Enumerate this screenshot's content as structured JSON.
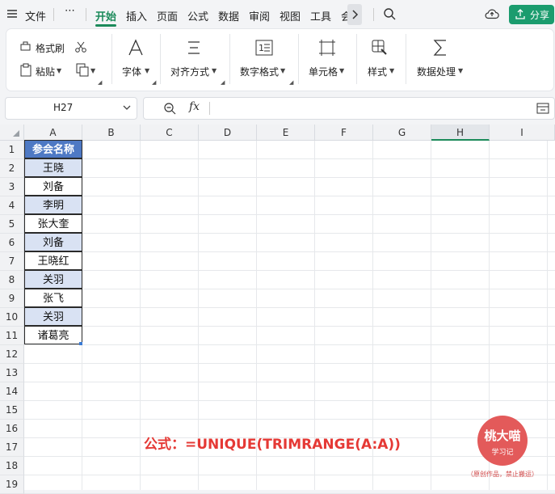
{
  "menu": {
    "file": "文件",
    "more": "⋯",
    "tabs": [
      "开始",
      "插入",
      "页面",
      "公式",
      "数据",
      "审阅",
      "视图",
      "工具",
      "会"
    ],
    "share": "分享"
  },
  "ribbon": {
    "format_painter": "格式刷",
    "paste": "粘贴",
    "font": "字体",
    "align": "对齐方式",
    "number_format": "数字格式",
    "cell": "单元格",
    "style": "样式",
    "data_process": "数据处理"
  },
  "formula_bar": {
    "name_box": "H27",
    "fx": "fx",
    "value": ""
  },
  "grid": {
    "columns": [
      "A",
      "B",
      "C",
      "D",
      "E",
      "F",
      "G",
      "H",
      "I"
    ],
    "selected_column": "H",
    "rows": [
      "1",
      "2",
      "3",
      "4",
      "5",
      "6",
      "7",
      "8",
      "9",
      "10",
      "11",
      "12",
      "13",
      "14",
      "15",
      "16",
      "17",
      "18",
      "19"
    ],
    "column_a": [
      "参会名称",
      "王晓",
      "刘备",
      "李明",
      "张大奎",
      "刘备",
      "王晓红",
      "关羽",
      "张飞",
      "关羽",
      "诸葛亮"
    ]
  },
  "overlay": {
    "formula": "公式：=UNIQUE(TRIMRANGE(A:A))",
    "logo_line1": "桃大喵",
    "logo_line2": "学习记",
    "note": "（原创作品，禁止搬运）"
  },
  "colors": {
    "accent": "#1b8a5a",
    "header_fill": "#4e79c4",
    "band_fill": "#d9e2f3",
    "formula_text": "#e53935"
  }
}
